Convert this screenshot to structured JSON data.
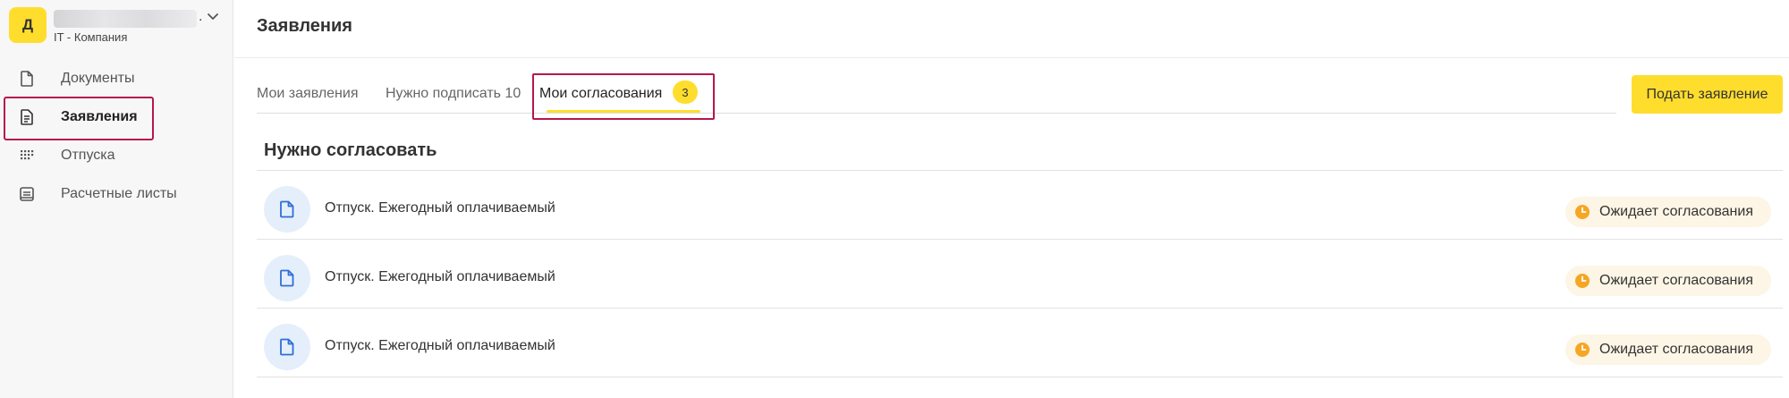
{
  "company": {
    "avatar_letter": "Д",
    "subtitle": "IT - Компания",
    "name_dot": "."
  },
  "sidebar": {
    "items": [
      {
        "label": "Документы",
        "icon": "document-icon",
        "active": false
      },
      {
        "label": "Заявления",
        "icon": "application-icon",
        "active": true
      },
      {
        "label": "Отпуска",
        "icon": "calendar-dots-icon",
        "active": false
      },
      {
        "label": "Расчетные листы",
        "icon": "payslip-icon",
        "active": false
      }
    ]
  },
  "header": {
    "title": "Заявления"
  },
  "tabs": [
    {
      "label": "Мои заявления"
    },
    {
      "label": "Нужно подписать 10"
    },
    {
      "label": "Мои согласования",
      "badge": "3",
      "active": true
    }
  ],
  "actions": {
    "submit_label": "Подать заявление"
  },
  "section": {
    "title": "Нужно согласовать"
  },
  "rows": [
    {
      "title": "Отпуск. Ежегодный оплачиваемый",
      "status": "Ожидает согласования"
    },
    {
      "title": "Отпуск. Ежегодный оплачиваемый",
      "status": "Ожидает согласования"
    },
    {
      "title": "Отпуск. Ежегодный оплачиваемый",
      "status": "Ожидает согласования"
    }
  ],
  "colors": {
    "accent": "#ffdd2d",
    "highlight": "#b4174c",
    "icon_blue": "#2f6fd6",
    "status_orange": "#f5a623"
  }
}
